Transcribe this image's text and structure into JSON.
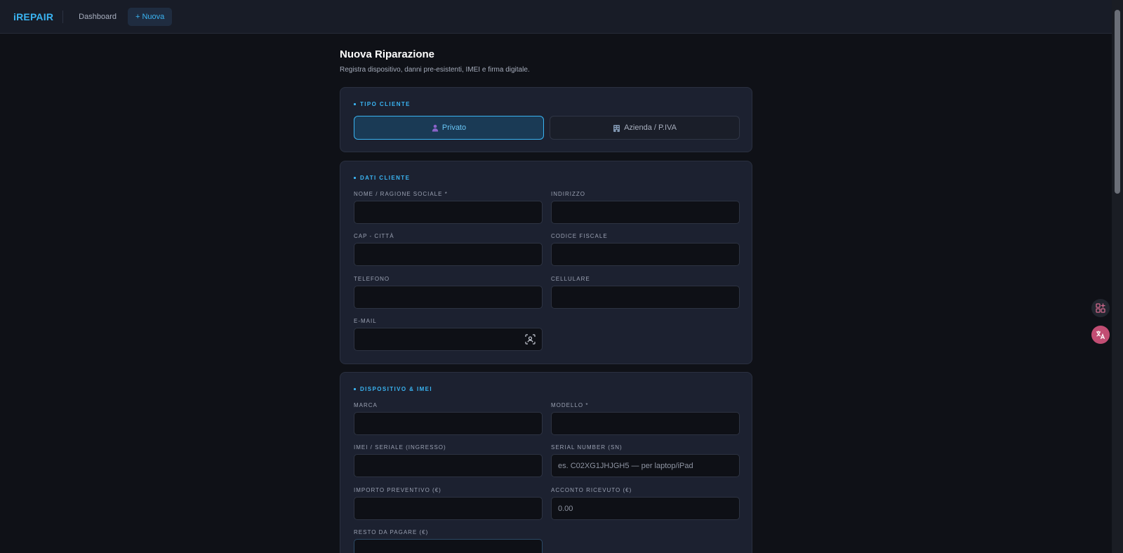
{
  "header": {
    "logo": "iREPAIR",
    "nav": [
      {
        "label": "Dashboard"
      },
      {
        "label": "+ Nuova"
      }
    ]
  },
  "page": {
    "title": "Nuova Riparazione",
    "subtitle": "Registra dispositivo, danni pre-esistenti, IMEI e firma digitale."
  },
  "tipo_cliente": {
    "title": "TIPO CLIENTE",
    "privato": "Privato",
    "azienda": "Azienda / P.IVA"
  },
  "dati_cliente": {
    "title": "DATI CLIENTE",
    "nome_label": "NOME / RAGIONE SOCIALE *",
    "indirizzo_label": "INDIRIZZO",
    "cap_label": "CAP - CITTÀ",
    "cf_label": "CODICE FISCALE",
    "telefono_label": "TELEFONO",
    "cellulare_label": "CELLULARE",
    "email_label": "E-MAIL"
  },
  "dispositivo": {
    "title": "DISPOSITIVO & IMEI",
    "marca_label": "MARCA",
    "modello_label": "MODELLO *",
    "imei_label": "IMEI / SERIALE (INGRESSO)",
    "sn_label": "SERIAL NUMBER (SN)",
    "sn_placeholder": "es. C02XG1JHJGH5 — per laptop/iPad",
    "preventivo_label": "IMPORTO PREVENTIVO (€)",
    "acconto_label": "ACCONTO RICEVUTO (€)",
    "acconto_placeholder": "0.00",
    "resto_label": "RESTO DA PAGARE (€)"
  },
  "colors": {
    "accent": "#3ab4f2",
    "background": "#0f1117",
    "card": "#1c2130"
  }
}
